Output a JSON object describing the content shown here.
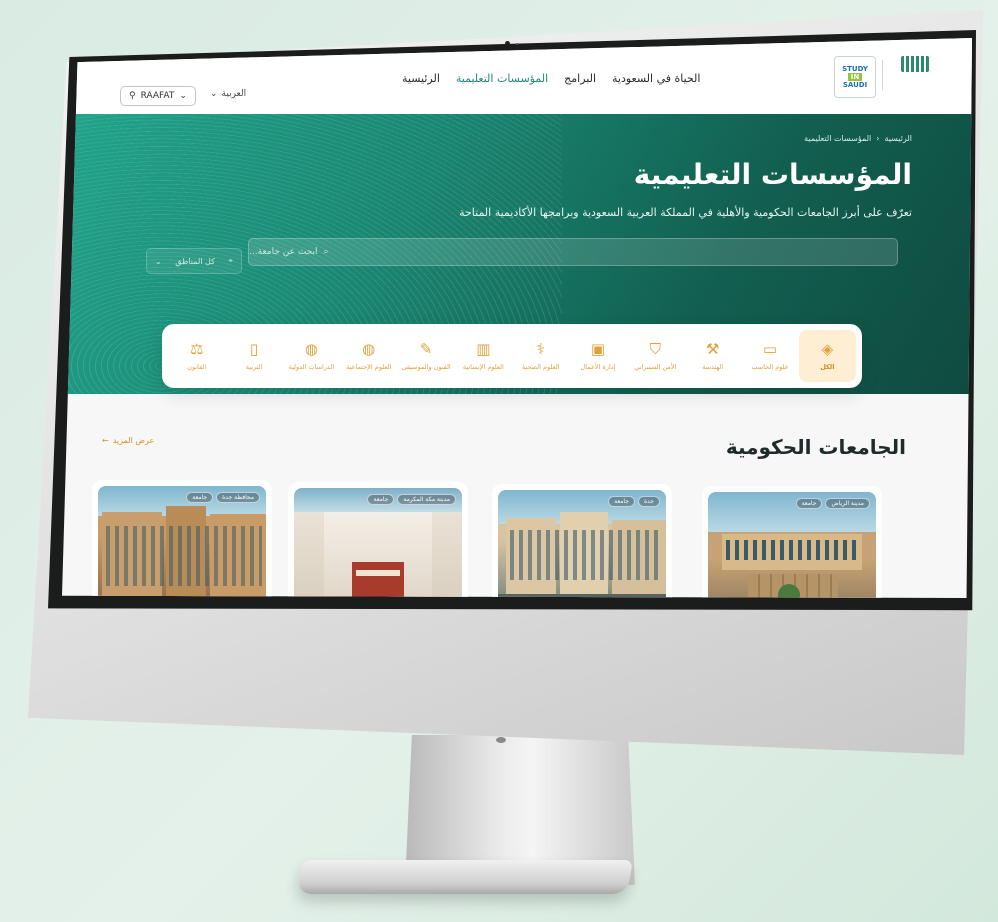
{
  "nav": {
    "logo_line1": "STUDY",
    "logo_line2": "IN",
    "logo_line3": "SAUDI",
    "links": [
      "الرئيسية",
      "المؤسسات التعليمية",
      "البرامج",
      "الحياة في السعودية"
    ],
    "active_link": "المؤسسات التعليمية",
    "user_label": "RAAFAT",
    "language": "العربية"
  },
  "hero": {
    "breadcrumb": [
      "الرئيسية",
      "المؤسسات التعليمية"
    ],
    "title": "المؤسسات التعليمية",
    "subtitle": "تعرّف على أبرز الجامعات الحكومية والأهلية في المملكة العربية السعودية وبرامجها الأكاديمية المتاحة",
    "search_placeholder": "ابحث عن جامعة...",
    "region_select": "كل المناطق"
  },
  "categories": [
    {
      "label": "الكل",
      "icon": "layers-icon",
      "glyph": "◈",
      "active": true
    },
    {
      "label": "علوم الحاسب",
      "icon": "laptop-icon",
      "glyph": "▭"
    },
    {
      "label": "الهندسة",
      "icon": "wrench-icon",
      "glyph": "⚒"
    },
    {
      "label": "الأمن السيبراني",
      "icon": "shield-icon",
      "glyph": "⛉"
    },
    {
      "label": "إدارة الأعمال",
      "icon": "briefcase-icon",
      "glyph": "▣"
    },
    {
      "label": "العلوم الصحية",
      "icon": "stethoscope-icon",
      "glyph": "⚕"
    },
    {
      "label": "العلوم الإنسانية",
      "icon": "books-icon",
      "glyph": "▥"
    },
    {
      "label": "الفنون والموسيقى",
      "icon": "brush-icon",
      "glyph": "✎"
    },
    {
      "label": "العلوم الإجتماعية",
      "icon": "globe-icon",
      "glyph": "◍"
    },
    {
      "label": "الدراسات الدولية",
      "icon": "globe-icon",
      "glyph": "◍"
    },
    {
      "label": "التربية",
      "icon": "book-icon",
      "glyph": "▯"
    },
    {
      "label": "القانون",
      "icon": "scales-icon",
      "glyph": "⚖"
    }
  ],
  "section": {
    "title": "الجامعات الحكومية",
    "more_link": "عرض المزيد"
  },
  "cards": [
    {
      "tags": [
        "مدينة الرياض",
        "جامعة"
      ]
    },
    {
      "tags": [
        "جدة",
        "جامعة"
      ]
    },
    {
      "tags": [
        "مدينة مكة المكرمة",
        "جامعة"
      ]
    },
    {
      "tags": [
        "محافظة جدة",
        "جامعة"
      ]
    }
  ]
}
